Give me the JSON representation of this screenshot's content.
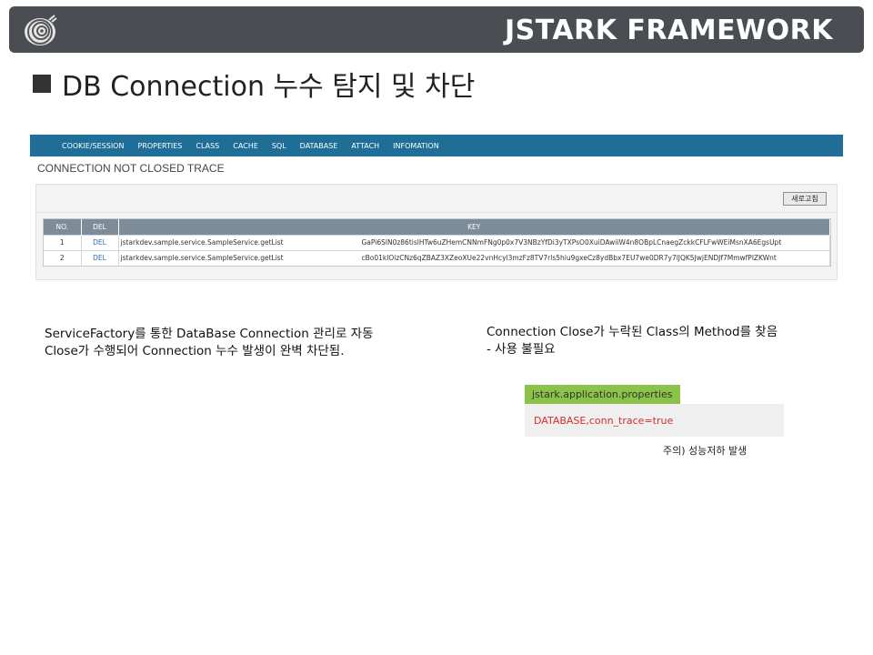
{
  "header": {
    "brand": "JSTARK FRAMEWORK",
    "logo_icon": "snail-logo-icon"
  },
  "slide": {
    "title": "DB Connection 누수 탐지 및 차단"
  },
  "screen": {
    "nav": [
      "COOKIE/SESSION",
      "PROPERTIES",
      "CLASS",
      "CACHE",
      "SQL",
      "DATABASE",
      "ATTACH",
      "INFOMATION"
    ],
    "trace_title": "CONNECTION NOT CLOSED TRACE",
    "refresh_label": "새로고침",
    "table": {
      "headers": {
        "no": "NO.",
        "del": "DEL",
        "key": "KEY"
      },
      "rows": [
        {
          "no": "1",
          "del": "DEL",
          "cls": "jstarkdev.sample.service.SampleService.getList",
          "key": "GaPi6SlN0z86tislHTw6uZHemCNNmFNg0p0x7V3NBzYfDi3yTXPsO0XuiDAwiiW4n8OBpLCnaegZckkCFLFwWEiMsnXA6EgsUpt"
        },
        {
          "no": "2",
          "del": "DEL",
          "cls": "jstarkdev.sample.service.SampleService.getList",
          "key": "cBo01klOizCNz6qZBAZ3XZeoXUe22vnHcyl3mzFz8TV7rls5hiu9gxeCz8ydBbx7EU7we0DR7y7lJQK5JwjENDJf7MmwfPlZKWnt"
        }
      ]
    }
  },
  "desc_left": {
    "line1": "ServiceFactory를 통한 DataBase Connection 관리로 자동",
    "line2": "Close가 수행되어 Connection 누수 발생이 완벽 차단됨."
  },
  "desc_right": {
    "line1": "Connection Close가 누락된 Class의 Method를 찾음",
    "line2": "- 사용 불필요"
  },
  "properties": {
    "file": "jstark.application.properties",
    "value": "DATABASE,conn_trace=true"
  },
  "note": "주의) 성능저하 발생"
}
